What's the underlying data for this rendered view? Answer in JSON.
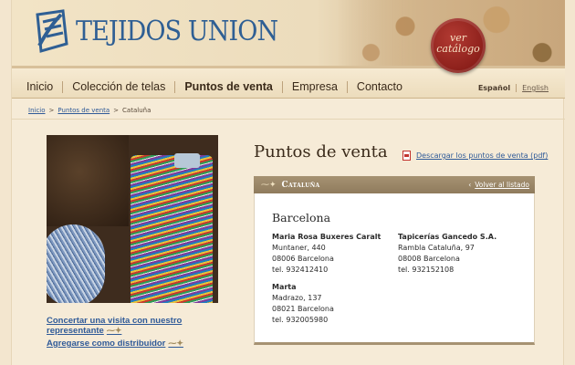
{
  "brand": {
    "name": "TEJIDOS UNION",
    "seal_line1": "ver",
    "seal_line2": "catálogo"
  },
  "nav": {
    "items": [
      "Inicio",
      "Colección de telas",
      "Puntos de venta",
      "Empresa",
      "Contacto"
    ],
    "active_index": 2
  },
  "language": {
    "es": "Español",
    "en": "English"
  },
  "breadcrumb": [
    "Inicio",
    "Puntos de venta",
    "Cataluña"
  ],
  "page": {
    "title": "Puntos de venta",
    "pdf_link": "Descargar los puntos de venta (pdf)",
    "region": "Cataluña",
    "back_link": "Volver al listado",
    "city": "Barcelona"
  },
  "stores": [
    {
      "name": "Maria Rosa Buxeres Caralt",
      "address": "Muntaner, 440",
      "postal": "08006 Barcelona",
      "phone": "tel. 932412410"
    },
    {
      "name": "Tapicerías Gancedo S.A.",
      "address": "Rambla Cataluña, 97",
      "postal": "08008 Barcelona",
      "phone": "tel. 932152108"
    },
    {
      "name": "Marta",
      "address": "Madrazo, 137",
      "postal": "08021 Barcelona",
      "phone": "tel. 932005980"
    }
  ],
  "sidebar": {
    "link1_line1": "Concertar una visita con nuestro",
    "link1_line2": "representante",
    "link2": "Agregarse como distribuidor"
  },
  "icons": {
    "logo": "tu-monogram-icon",
    "pdf": "pdf-icon",
    "sprig": "sprig-ornament-icon",
    "back": "chevron-left-icon"
  },
  "colors": {
    "brand_blue": "#2f5f94",
    "link": "#2f5a98",
    "seal": "#8b1f1a",
    "panel_head": "#a69272",
    "background": "#f6ebd7"
  }
}
